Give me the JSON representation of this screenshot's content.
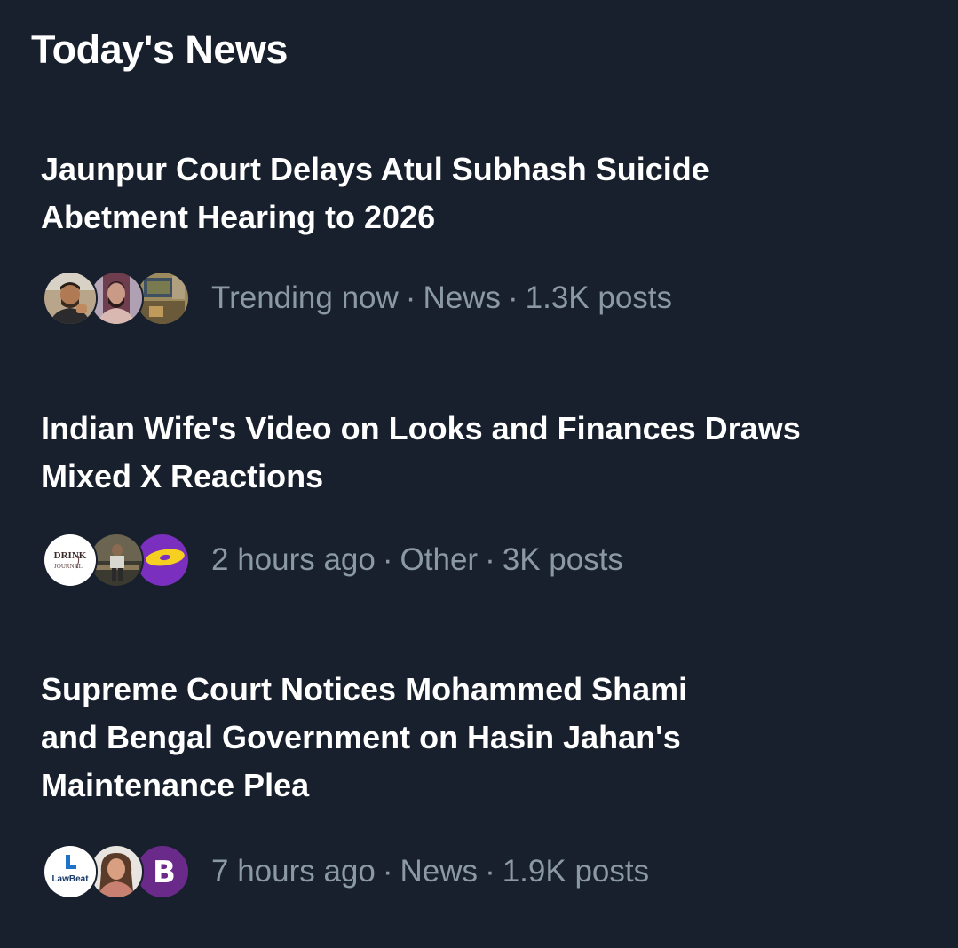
{
  "section": {
    "title": "Today's News"
  },
  "stories": [
    {
      "headline_lines": [
        "Jaunpur Court Delays Atul Subhash Suicide",
        "Abetment Hearing to 2026"
      ],
      "time": "Trending now",
      "category": "News",
      "posts": "1.3K posts",
      "avatars": [
        "man-portrait-avatar",
        "bearded-man-avatar",
        "room-photo-avatar"
      ]
    },
    {
      "headline_lines": [
        "Indian Wife's Video on Looks and Finances Draws",
        "Mixed X Reactions"
      ],
      "time": "2 hours ago",
      "category": "Other",
      "posts": "3K posts",
      "avatars": [
        "drink-journal-logo-avatar",
        "seated-person-avatar",
        "purple-disc-logo-avatar"
      ],
      "logo_text": [
        "DRINK",
        "JOURNAL"
      ]
    },
    {
      "headline_lines": [
        "Supreme Court Notices Mohammed Shami",
        "and Bengal Government on Hasin Jahan's",
        "Maintenance Plea"
      ],
      "time": "7 hours ago",
      "category": "News",
      "posts": "1.9K posts",
      "avatars": [
        "lawbeat-logo-avatar",
        "woman-portrait-avatar",
        "b-letter-logo-avatar"
      ],
      "logo_text": [
        "LawBeat",
        "B"
      ]
    }
  ],
  "colors": {
    "background": "#17202c",
    "headline": "#ffffff",
    "meta": "#8b98a5",
    "purple_accent": "#7b2fbe"
  }
}
